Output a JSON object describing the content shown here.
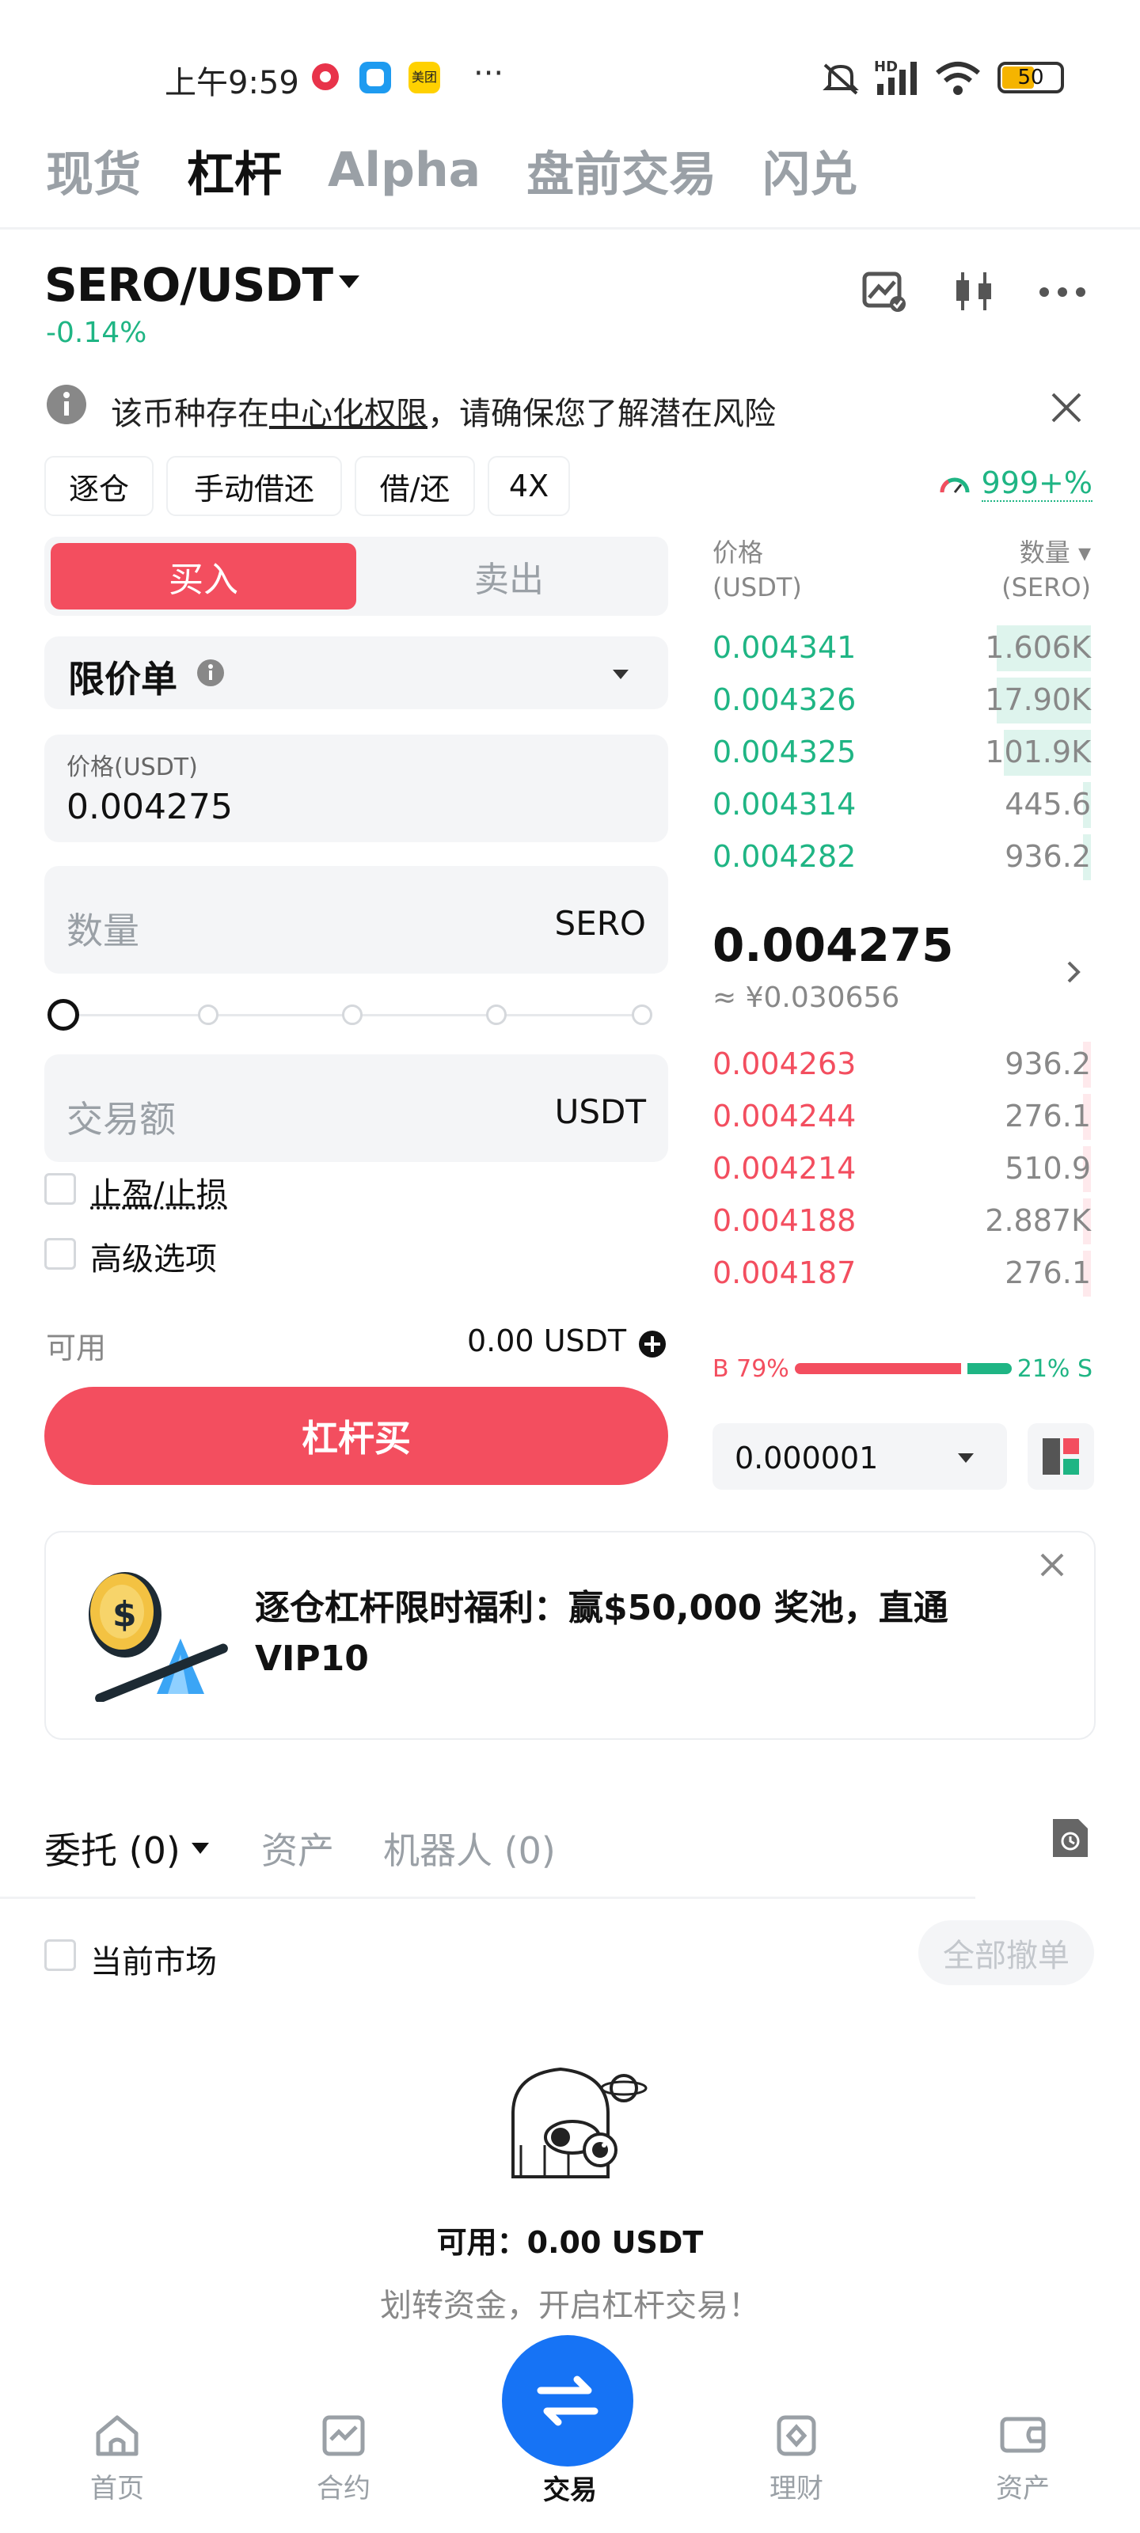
{
  "status_bar": {
    "time": "上午9:59",
    "meituan_badge": "美团",
    "dots": "···",
    "hd": "HD",
    "battery": "50"
  },
  "top_tabs": [
    "现货",
    "杠杆",
    "Alpha",
    "盘前交易",
    "闪兑"
  ],
  "active_tab": "杠杆",
  "pair": {
    "symbol": "SERO/USDT",
    "change": "-0.14%"
  },
  "notice": {
    "prefix": "该币种存在",
    "link": "中心化权限",
    "suffix": "，请确保您了解潜在风险"
  },
  "chips": [
    "逐仓",
    "手动借还",
    "借/还",
    "4X"
  ],
  "rate": "999+%",
  "form": {
    "buy": "买入",
    "sell": "卖出",
    "order_type": "限价单",
    "price_label": "价格(USDT)",
    "price_value": "0.004275",
    "qty_placeholder": "数量",
    "qty_unit": "SERO",
    "amount_placeholder": "交易额",
    "amount_unit": "USDT",
    "tpsl": "止盈/止损",
    "advanced": "高级选项",
    "available_label": "可用",
    "available_value": "0.00 USDT",
    "submit": "杠杆买"
  },
  "order_book": {
    "price_header": "价格",
    "price_unit": "(USDT)",
    "qty_header": "数量",
    "qty_unit": "(SERO)",
    "asks": [
      {
        "price": "0.004341",
        "qty": "1.606K",
        "depth": 0.25
      },
      {
        "price": "0.004326",
        "qty": "17.90K",
        "depth": 0.25
      },
      {
        "price": "0.004325",
        "qty": "101.9K",
        "depth": 0.23
      },
      {
        "price": "0.004314",
        "qty": "445.6",
        "depth": 0.02
      },
      {
        "price": "0.004282",
        "qty": "936.2",
        "depth": 0.02
      }
    ],
    "mid_price": "0.004275",
    "mid_cny": "≈ ¥0.030656",
    "bids": [
      {
        "price": "0.004263",
        "qty": "936.2",
        "depth": 0.02
      },
      {
        "price": "0.004244",
        "qty": "276.1",
        "depth": 0.02
      },
      {
        "price": "0.004214",
        "qty": "510.9",
        "depth": 0.02
      },
      {
        "price": "0.004188",
        "qty": "2.887K",
        "depth": 0.02
      },
      {
        "price": "0.004187",
        "qty": "276.1",
        "depth": 0.02
      }
    ],
    "buy_ratio": "B 79%",
    "sell_ratio": "21% S",
    "tick_size": "0.000001"
  },
  "promo": {
    "text": "逐仓杠杆限时福利：赢$50,000 奖池，直通VIP10"
  },
  "orders": {
    "tabs": [
      "委托 (0)",
      "资产",
      "机器人 (0)"
    ],
    "current_market": "当前市场",
    "cancel_all": "全部撤单",
    "empty_available": "可用：0.00 USDT",
    "empty_hint": "划转资金，开启杠杆交易！"
  },
  "bottom_nav": [
    "首页",
    "合约",
    "交易",
    "理财",
    "资产"
  ],
  "colors": {
    "green": "#1fb584",
    "red": "#f34e5f",
    "blue": "#1673f5"
  }
}
